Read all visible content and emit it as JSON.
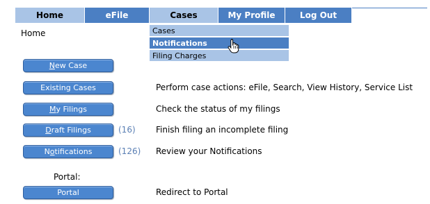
{
  "nav": {
    "tabs": [
      "Home",
      "eFile",
      "Cases",
      "My Profile",
      "Log Out"
    ]
  },
  "dropdown": {
    "items": [
      "Cases",
      "Notifications",
      "Filing Charges"
    ]
  },
  "breadcrumb": "Home",
  "buttons": {
    "new_case": {
      "pre": "",
      "key": "N",
      "post": "ew Case"
    },
    "existing_cases": {
      "label": "Existing Cases"
    },
    "my_filings": {
      "pre": "",
      "key": "M",
      "post": "y Filings"
    },
    "draft_filings": {
      "pre": "",
      "key": "D",
      "post": "raft Filings"
    },
    "notifications": {
      "pre": "N",
      "key": "o",
      "post": "tifications"
    },
    "portal": {
      "label": "Portal"
    }
  },
  "counts": {
    "draft_filings": "(16)",
    "notifications": "(126)"
  },
  "descriptions": {
    "existing_cases": "Perform case actions: eFile, Search, View History, Service List",
    "my_filings": "Check the status of my filings",
    "draft_filings": "Finish filing an incomplete filing",
    "notifications": "Review your Notifications",
    "portal": "Redirect to Portal"
  },
  "portal_label": "Portal:",
  "colors": {
    "nav_dark": "#4b7fc3",
    "nav_light": "#a9c4e6",
    "button": "#4b86cf"
  },
  "cursor_icon": "hand-pointer-icon"
}
